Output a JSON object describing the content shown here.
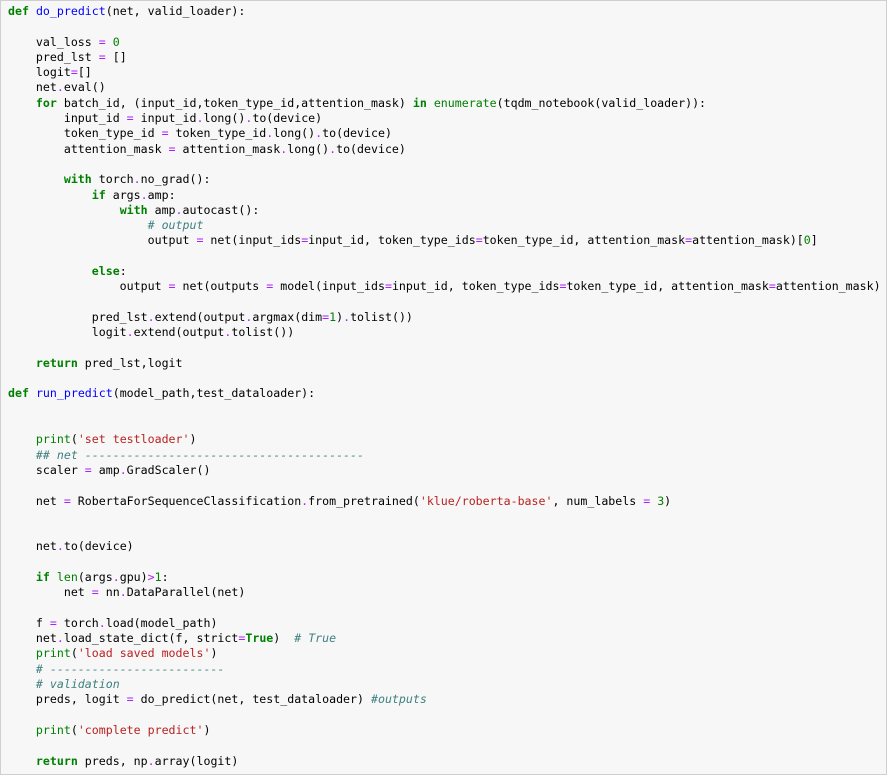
{
  "lines": [
    [
      [
        "k",
        "def"
      ],
      [
        "t",
        " "
      ],
      [
        "f",
        "do_predict"
      ],
      [
        "t",
        "(net, valid_loader):"
      ]
    ],
    [],
    [
      [
        "t",
        "    val_loss "
      ],
      [
        "o",
        "="
      ],
      [
        "t",
        " "
      ],
      [
        "n",
        "0"
      ]
    ],
    [
      [
        "t",
        "    pred_lst "
      ],
      [
        "o",
        "="
      ],
      [
        "t",
        " []"
      ]
    ],
    [
      [
        "t",
        "    logit"
      ],
      [
        "o",
        "="
      ],
      [
        "t",
        "[]"
      ]
    ],
    [
      [
        "t",
        "    net"
      ],
      [
        "o",
        "."
      ],
      [
        "t",
        "eval()"
      ]
    ],
    [
      [
        "t",
        "    "
      ],
      [
        "k",
        "for"
      ],
      [
        "t",
        " batch_id, (input_id,token_type_id,attention_mask) "
      ],
      [
        "k",
        "in"
      ],
      [
        "t",
        " "
      ],
      [
        "b",
        "enumerate"
      ],
      [
        "t",
        "(tqdm_notebook(valid_loader)):"
      ]
    ],
    [
      [
        "t",
        "        input_id "
      ],
      [
        "o",
        "="
      ],
      [
        "t",
        " input_id"
      ],
      [
        "o",
        "."
      ],
      [
        "t",
        "long()"
      ],
      [
        "o",
        "."
      ],
      [
        "t",
        "to(device)"
      ]
    ],
    [
      [
        "t",
        "        token_type_id "
      ],
      [
        "o",
        "="
      ],
      [
        "t",
        " token_type_id"
      ],
      [
        "o",
        "."
      ],
      [
        "t",
        "long()"
      ],
      [
        "o",
        "."
      ],
      [
        "t",
        "to(device)"
      ]
    ],
    [
      [
        "t",
        "        attention_mask "
      ],
      [
        "o",
        "="
      ],
      [
        "t",
        " attention_mask"
      ],
      [
        "o",
        "."
      ],
      [
        "t",
        "long()"
      ],
      [
        "o",
        "."
      ],
      [
        "t",
        "to(device)"
      ]
    ],
    [],
    [
      [
        "t",
        "        "
      ],
      [
        "k",
        "with"
      ],
      [
        "t",
        " torch"
      ],
      [
        "o",
        "."
      ],
      [
        "t",
        "no_grad():"
      ]
    ],
    [
      [
        "t",
        "            "
      ],
      [
        "k",
        "if"
      ],
      [
        "t",
        " args"
      ],
      [
        "o",
        "."
      ],
      [
        "t",
        "amp:"
      ]
    ],
    [
      [
        "t",
        "                "
      ],
      [
        "k",
        "with"
      ],
      [
        "t",
        " amp"
      ],
      [
        "o",
        "."
      ],
      [
        "t",
        "autocast():"
      ]
    ],
    [
      [
        "t",
        "                    "
      ],
      [
        "c",
        "# output"
      ]
    ],
    [
      [
        "t",
        "                    output "
      ],
      [
        "o",
        "="
      ],
      [
        "t",
        " net(input_ids"
      ],
      [
        "o",
        "="
      ],
      [
        "t",
        "input_id, token_type_ids"
      ],
      [
        "o",
        "="
      ],
      [
        "t",
        "token_type_id, attention_mask"
      ],
      [
        "o",
        "="
      ],
      [
        "t",
        "attention_mask)["
      ],
      [
        "n",
        "0"
      ],
      [
        "t",
        "]"
      ]
    ],
    [],
    [
      [
        "t",
        "            "
      ],
      [
        "k",
        "else"
      ],
      [
        "t",
        ":"
      ]
    ],
    [
      [
        "t",
        "                output "
      ],
      [
        "o",
        "="
      ],
      [
        "t",
        " net(outputs "
      ],
      [
        "o",
        "="
      ],
      [
        "t",
        " model(input_ids"
      ],
      [
        "o",
        "="
      ],
      [
        "t",
        "input_id, token_type_ids"
      ],
      [
        "o",
        "="
      ],
      [
        "t",
        "token_type_id, attention_mask"
      ],
      [
        "o",
        "="
      ],
      [
        "t",
        "attention_mask)"
      ]
    ],
    [],
    [
      [
        "t",
        "            pred_lst"
      ],
      [
        "o",
        "."
      ],
      [
        "t",
        "extend(output"
      ],
      [
        "o",
        "."
      ],
      [
        "t",
        "argmax(dim"
      ],
      [
        "o",
        "="
      ],
      [
        "n",
        "1"
      ],
      [
        "t",
        ")"
      ],
      [
        "o",
        "."
      ],
      [
        "t",
        "tolist())"
      ]
    ],
    [
      [
        "t",
        "            logit"
      ],
      [
        "o",
        "."
      ],
      [
        "t",
        "extend(output"
      ],
      [
        "o",
        "."
      ],
      [
        "t",
        "tolist())"
      ]
    ],
    [],
    [
      [
        "t",
        "    "
      ],
      [
        "k",
        "return"
      ],
      [
        "t",
        " pred_lst,logit"
      ]
    ],
    [],
    [
      [
        "k",
        "def"
      ],
      [
        "t",
        " "
      ],
      [
        "f",
        "run_predict"
      ],
      [
        "t",
        "(model_path,test_dataloader):"
      ]
    ],
    [],
    [],
    [
      [
        "t",
        "    "
      ],
      [
        "b",
        "print"
      ],
      [
        "t",
        "("
      ],
      [
        "s",
        "'set testloader'"
      ],
      [
        "t",
        ")"
      ]
    ],
    [
      [
        "t",
        "    "
      ],
      [
        "c",
        "## net ----------------------------------------"
      ]
    ],
    [
      [
        "t",
        "    scaler "
      ],
      [
        "o",
        "="
      ],
      [
        "t",
        " amp"
      ],
      [
        "o",
        "."
      ],
      [
        "t",
        "GradScaler()"
      ]
    ],
    [],
    [
      [
        "t",
        "    net "
      ],
      [
        "o",
        "="
      ],
      [
        "t",
        " RobertaForSequenceClassification"
      ],
      [
        "o",
        "."
      ],
      [
        "t",
        "from_pretrained("
      ],
      [
        "s",
        "'klue/roberta-base'"
      ],
      [
        "t",
        ", num_labels "
      ],
      [
        "o",
        "="
      ],
      [
        "t",
        " "
      ],
      [
        "n",
        "3"
      ],
      [
        "t",
        ")"
      ]
    ],
    [],
    [],
    [
      [
        "t",
        "    net"
      ],
      [
        "o",
        "."
      ],
      [
        "t",
        "to(device)"
      ]
    ],
    [],
    [
      [
        "t",
        "    "
      ],
      [
        "k",
        "if"
      ],
      [
        "t",
        " "
      ],
      [
        "b",
        "len"
      ],
      [
        "t",
        "(args"
      ],
      [
        "o",
        "."
      ],
      [
        "t",
        "gpu)"
      ],
      [
        "o",
        ">"
      ],
      [
        "n",
        "1"
      ],
      [
        "t",
        ":"
      ]
    ],
    [
      [
        "t",
        "        net "
      ],
      [
        "o",
        "="
      ],
      [
        "t",
        " nn"
      ],
      [
        "o",
        "."
      ],
      [
        "t",
        "DataParallel(net)"
      ]
    ],
    [],
    [
      [
        "t",
        "    f "
      ],
      [
        "o",
        "="
      ],
      [
        "t",
        " torch"
      ],
      [
        "o",
        "."
      ],
      [
        "t",
        "load(model_path)"
      ]
    ],
    [
      [
        "t",
        "    net"
      ],
      [
        "o",
        "."
      ],
      [
        "t",
        "load_state_dict(f, strict"
      ],
      [
        "o",
        "="
      ],
      [
        "k",
        "True"
      ],
      [
        "t",
        ")  "
      ],
      [
        "c",
        "# True"
      ]
    ],
    [
      [
        "t",
        "    "
      ],
      [
        "b",
        "print"
      ],
      [
        "t",
        "("
      ],
      [
        "s",
        "'load saved models'"
      ],
      [
        "t",
        ")"
      ]
    ],
    [
      [
        "t",
        "    "
      ],
      [
        "c",
        "# -------------------------"
      ]
    ],
    [
      [
        "t",
        "    "
      ],
      [
        "c",
        "# validation"
      ]
    ],
    [
      [
        "t",
        "    preds, logit "
      ],
      [
        "o",
        "="
      ],
      [
        "t",
        " do_predict(net, test_dataloader) "
      ],
      [
        "c",
        "#outputs"
      ]
    ],
    [],
    [
      [
        "t",
        "    "
      ],
      [
        "b",
        "print"
      ],
      [
        "t",
        "("
      ],
      [
        "s",
        "'complete predict'"
      ],
      [
        "t",
        ")"
      ]
    ],
    [],
    [
      [
        "t",
        "    "
      ],
      [
        "k",
        "return"
      ],
      [
        "t",
        " preds, np"
      ],
      [
        "o",
        "."
      ],
      [
        "t",
        "array(logit)"
      ]
    ]
  ]
}
